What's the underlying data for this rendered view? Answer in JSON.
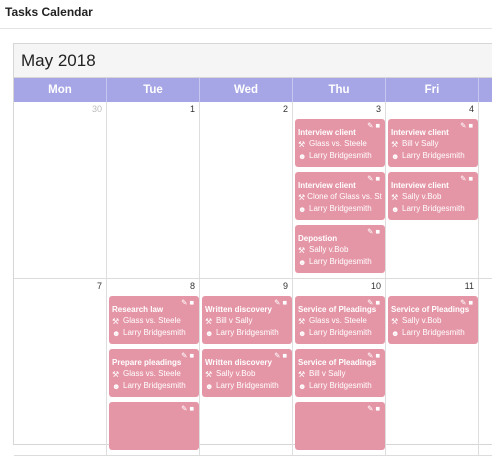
{
  "app": {
    "title": "Tasks Calendar"
  },
  "calendar": {
    "month_title": "May 2018",
    "day_names": [
      "Mon",
      "Tue",
      "Wed",
      "Thu",
      "Fri"
    ],
    "weeks": [
      {
        "days": [
          {
            "number": "30",
            "other_month": true
          },
          {
            "number": "1"
          },
          {
            "number": "2"
          },
          {
            "number": "3"
          },
          {
            "number": "4"
          }
        ],
        "events": [
          {
            "day": 3,
            "slot": 0,
            "title": "Interview client",
            "case": "Glass vs. Steele",
            "person": "Larry Bridgesmith"
          },
          {
            "day": 3,
            "slot": 1,
            "title": "Interview client",
            "case": "Clone of Glass vs. Steele",
            "person": "Larry Bridgesmith"
          },
          {
            "day": 3,
            "slot": 2,
            "title": "Depostion",
            "case": "Sally v.Bob",
            "person": "Larry Bridgesmith"
          },
          {
            "day": 4,
            "slot": 0,
            "title": "Interview client",
            "case": "Bill v Sally",
            "person": "Larry Bridgesmith"
          },
          {
            "day": 4,
            "slot": 1,
            "title": "Interview client",
            "case": "Sally v.Bob",
            "person": "Larry Bridgesmith"
          }
        ]
      },
      {
        "days": [
          {
            "number": "7"
          },
          {
            "number": "8"
          },
          {
            "number": "9"
          },
          {
            "number": "10"
          },
          {
            "number": "11"
          }
        ],
        "events": [
          {
            "day": 1,
            "slot": 0,
            "title": "Research law",
            "case": "Glass vs. Steele",
            "person": "Larry Bridgesmith"
          },
          {
            "day": 1,
            "slot": 1,
            "title": "Prepare pleadings",
            "case": "Glass vs. Steele",
            "person": "Larry Bridgesmith"
          },
          {
            "day": 2,
            "slot": 0,
            "title": "Written discovery",
            "case": "Bill v Sally",
            "person": "Larry Bridgesmith"
          },
          {
            "day": 2,
            "slot": 1,
            "title": "Written discovery",
            "case": "Sally v.Bob",
            "person": "Larry Bridgesmith"
          },
          {
            "day": 3,
            "slot": 0,
            "title": "Service of Pleadings",
            "case": "Glass vs. Steele",
            "person": "Larry Bridgesmith"
          },
          {
            "day": 3,
            "slot": 1,
            "title": "Service of Pleadings",
            "case": "Bill v Sally",
            "person": "Larry Bridgesmith"
          },
          {
            "day": 4,
            "slot": 0,
            "title": "Service of Pleadings",
            "case": "Sally v.Bob",
            "person": "Larry Bridgesmith"
          },
          {
            "day": 1,
            "slot": 2,
            "title": "",
            "case": "",
            "person": ""
          },
          {
            "day": 3,
            "slot": 2,
            "title": "",
            "case": "",
            "person": ""
          }
        ]
      }
    ]
  },
  "icons": {
    "case": "gavel-icon",
    "person": "user-icon",
    "edit": "pencil-icon",
    "delete": "trash-icon"
  },
  "colors": {
    "header_bar": "#a6a6e7",
    "event": "#e596a6"
  }
}
